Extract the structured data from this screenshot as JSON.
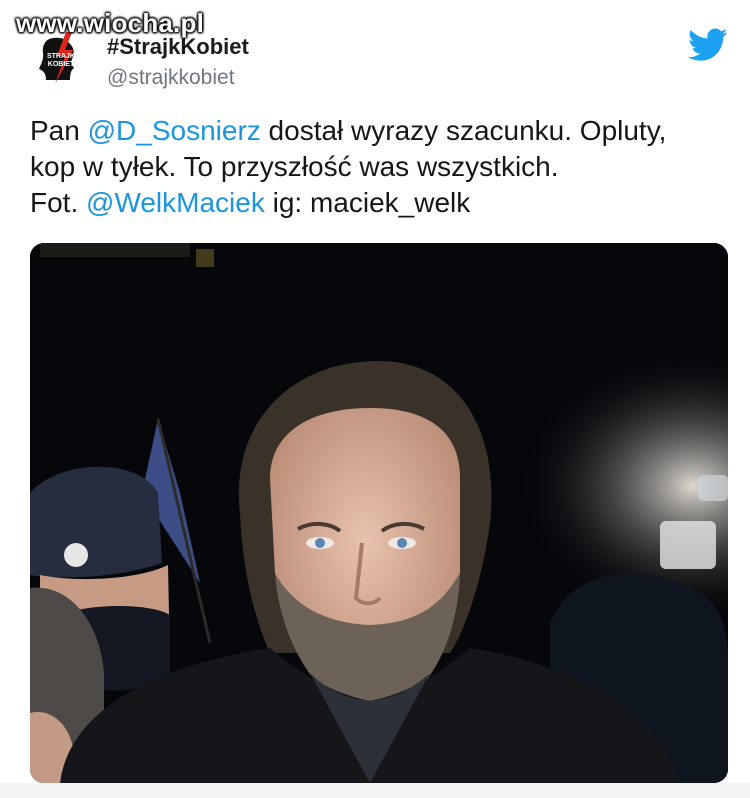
{
  "watermark": {
    "text": "www.wiocha.pl"
  },
  "tweet": {
    "author": {
      "display_name": "#StrajkKobiet",
      "handle": "@strajkkobiet",
      "avatar_logo_text": "STRAJK KOBIET"
    },
    "platform_icon": "twitter-bird-icon",
    "text": {
      "line1_prefix": "Pan ",
      "mention1": "@D_Sosnierz",
      "line1_suffix": " dostał wyrazy szacunku. Opluty,",
      "line2": "kop w tyłek. To przyszłość was wszystkich.",
      "line3_prefix": "Fot. ",
      "mention2": "@WelkMaciek",
      "line3_suffix": " ig: maciek_welk"
    },
    "photo": {
      "icon": "photo-image"
    }
  },
  "colors": {
    "mention": "#1b95e0",
    "twitter_blue": "#1da1f2",
    "handle_gray": "#6e7780",
    "logo_red": "#e2231a"
  }
}
